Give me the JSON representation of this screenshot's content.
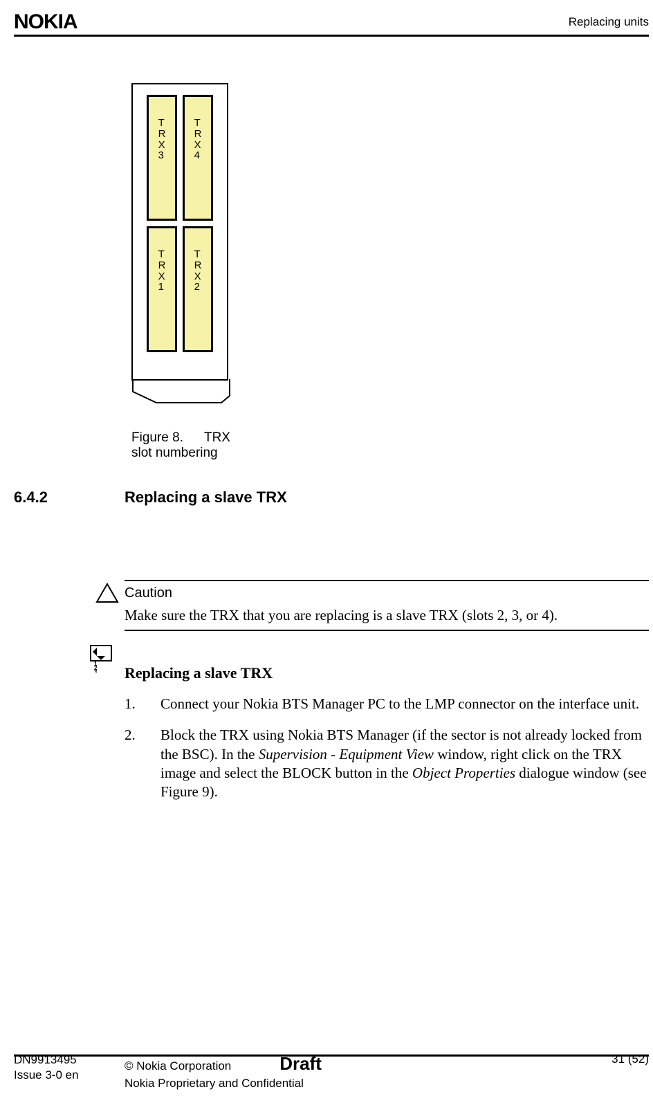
{
  "header": {
    "brand": "NOKIA",
    "section": "Replacing units"
  },
  "figure": {
    "slots": {
      "tl": "TRX3",
      "tr": "TRX4",
      "bl": "TRX1",
      "br": "TRX2"
    },
    "caption_label": "Figure 8.",
    "caption_text": "TRX slot numbering"
  },
  "section": {
    "number": "6.4.2",
    "title": "Replacing a slave TRX"
  },
  "caution": {
    "label": "Caution",
    "text": "Make sure the TRX that you are replacing is a slave TRX (slots 2, 3, or 4)."
  },
  "steps": {
    "title": "Replacing a slave TRX",
    "items": [
      {
        "n": "1.",
        "pre": "Connect your Nokia BTS Manager PC to the LMP connector on the interface unit."
      },
      {
        "n": "2.",
        "t1": "Block the TRX using Nokia BTS Manager (if the sector is not already locked from the BSC). In the ",
        "e1": "Supervision - Equipment View",
        "t2": " window, right click on the TRX image and select the BLOCK button in the ",
        "e2": "Object Properties",
        "t3": " dialogue window (see Figure 9)."
      }
    ]
  },
  "footer": {
    "doc": "DN9913495",
    "issue": "Issue 3-0 en",
    "copyright": "© Nokia Corporation",
    "confidential": "Nokia Proprietary and Confidential",
    "status": "Draft",
    "page": "31 (52)"
  }
}
